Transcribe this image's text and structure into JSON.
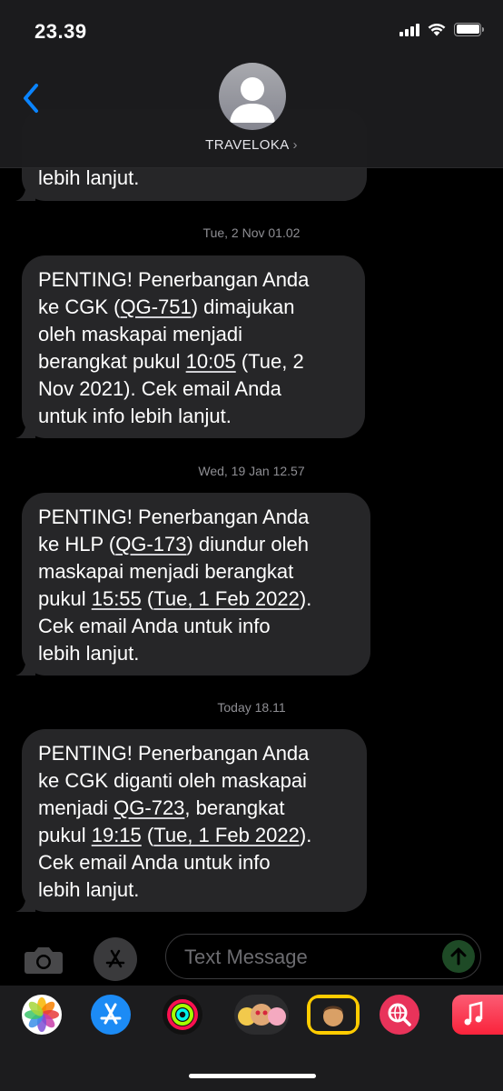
{
  "status_bar": {
    "time": "23.39"
  },
  "header": {
    "contact_name": "TRAVELOKA",
    "chevron": "›"
  },
  "messages": [
    {
      "lines": [
        [
          {
            "t": "lebih lanjut."
          }
        ]
      ]
    },
    {
      "timestamp": "Tue, 2 Nov 01.02",
      "lines": [
        [
          {
            "t": "PENTING! Penerbangan Anda"
          }
        ],
        [
          {
            "t": "ke CGK ("
          },
          {
            "t": "QG-751",
            "u": true
          },
          {
            "t": ") dimajukan"
          }
        ],
        [
          {
            "t": "oleh maskapai menjadi"
          }
        ],
        [
          {
            "t": "berangkat pukul "
          },
          {
            "t": "10:05",
            "u": true
          },
          {
            "t": " (Tue, 2"
          }
        ],
        [
          {
            "t": "Nov 2021). Cek email Anda"
          }
        ],
        [
          {
            "t": "untuk info lebih lanjut."
          }
        ]
      ]
    },
    {
      "timestamp": "Wed, 19 Jan 12.57",
      "lines": [
        [
          {
            "t": "PENTING! Penerbangan Anda"
          }
        ],
        [
          {
            "t": "ke HLP ("
          },
          {
            "t": "QG-173",
            "u": true
          },
          {
            "t": ") diundur oleh"
          }
        ],
        [
          {
            "t": "maskapai menjadi berangkat"
          }
        ],
        [
          {
            "t": "pukul "
          },
          {
            "t": "15:55",
            "u": true
          },
          {
            "t": " ("
          },
          {
            "t": "Tue, 1 Feb 2022",
            "u": true
          },
          {
            "t": ")."
          }
        ],
        [
          {
            "t": "Cek email Anda untuk info"
          }
        ],
        [
          {
            "t": "lebih lanjut."
          }
        ]
      ]
    },
    {
      "timestamp": "Today 18.11",
      "lines": [
        [
          {
            "t": "PENTING! Penerbangan Anda"
          }
        ],
        [
          {
            "t": "ke CGK diganti oleh maskapai"
          }
        ],
        [
          {
            "t": "menjadi "
          },
          {
            "t": "QG-723",
            "u": true
          },
          {
            "t": ", berangkat"
          }
        ],
        [
          {
            "t": "pukul "
          },
          {
            "t": "19:15",
            "u": true
          },
          {
            "t": " ("
          },
          {
            "t": "Tue, 1 Feb 2022",
            "u": true
          },
          {
            "t": ")."
          }
        ],
        [
          {
            "t": "Cek email Anda untuk info"
          }
        ],
        [
          {
            "t": "lebih lanjut."
          }
        ]
      ]
    }
  ],
  "compose": {
    "placeholder": "Text Message"
  },
  "app_strip": [
    {
      "icon": "photos-icon"
    },
    {
      "icon": "app-store-icon"
    },
    {
      "icon": "activity-icon"
    },
    {
      "icon": "memoji-stickers-icon"
    },
    {
      "icon": "memoji-icon"
    },
    {
      "icon": "web-search-icon"
    },
    {
      "icon": "music-icon"
    }
  ],
  "colors": {
    "bubble": "#262628",
    "header": "#1c1c1e",
    "accent_blue": "#0a84ff",
    "send_green": "#1e4a26"
  }
}
